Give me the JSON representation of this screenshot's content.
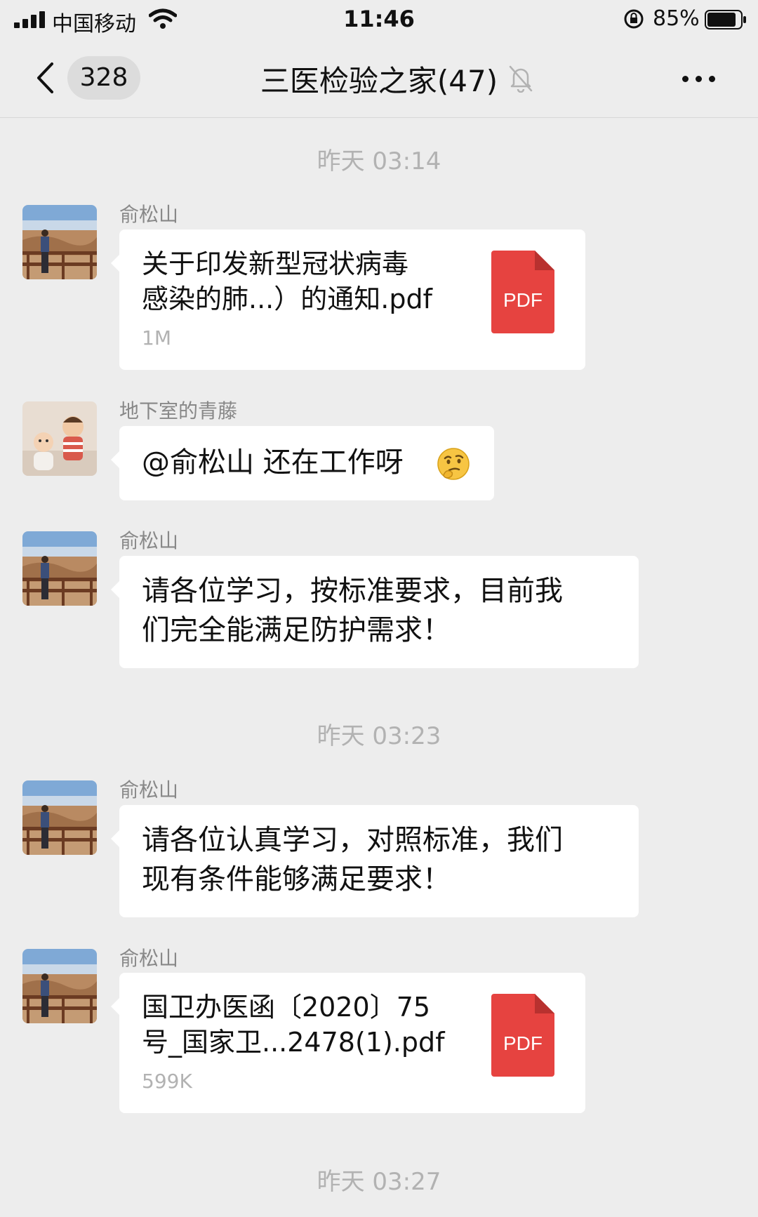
{
  "status": {
    "carrier": "中国移动",
    "time": "11:46",
    "battery": "85%"
  },
  "nav": {
    "unread_count": "328",
    "title": "三医检验之家(47)",
    "icons": [
      "chevron-left-icon",
      "bell-muted-icon",
      "more-dots-icon"
    ]
  },
  "messages": {
    "t1": "昨天 03:14",
    "m1": {
      "sender": "俞松山",
      "file_name_1": "关于印发新型冠状病毒",
      "file_name_2": "感染的肺...）的通知.pdf",
      "file_size": "1M",
      "file_icon": "PDF"
    },
    "m2": {
      "sender": "地下室的青藤",
      "text": "@俞松山 还在工作呀",
      "emoji": "thinking-face"
    },
    "m3": {
      "sender": "俞松山",
      "line_1": "请各位学习，按标准要求，目前我",
      "line_2": "们完全能满足防护需求！"
    },
    "t2": "昨天 03:23",
    "m4": {
      "sender": "俞松山",
      "line_1": "请各位认真学习，对照标准，我们",
      "line_2": "现有条件能够满足要求！"
    },
    "m5": {
      "sender": "俞松山",
      "file_name_1": "国卫办医函〔2020〕75",
      "file_name_2": "号_国家卫...2478(1).pdf",
      "file_size": "599K",
      "file_icon": "PDF"
    },
    "t3": "昨天 03:27"
  },
  "colors": {
    "background": "#ededed",
    "bubble": "#ffffff",
    "pdf_red": "#e64340",
    "muted_text": "#b2b2b2"
  }
}
